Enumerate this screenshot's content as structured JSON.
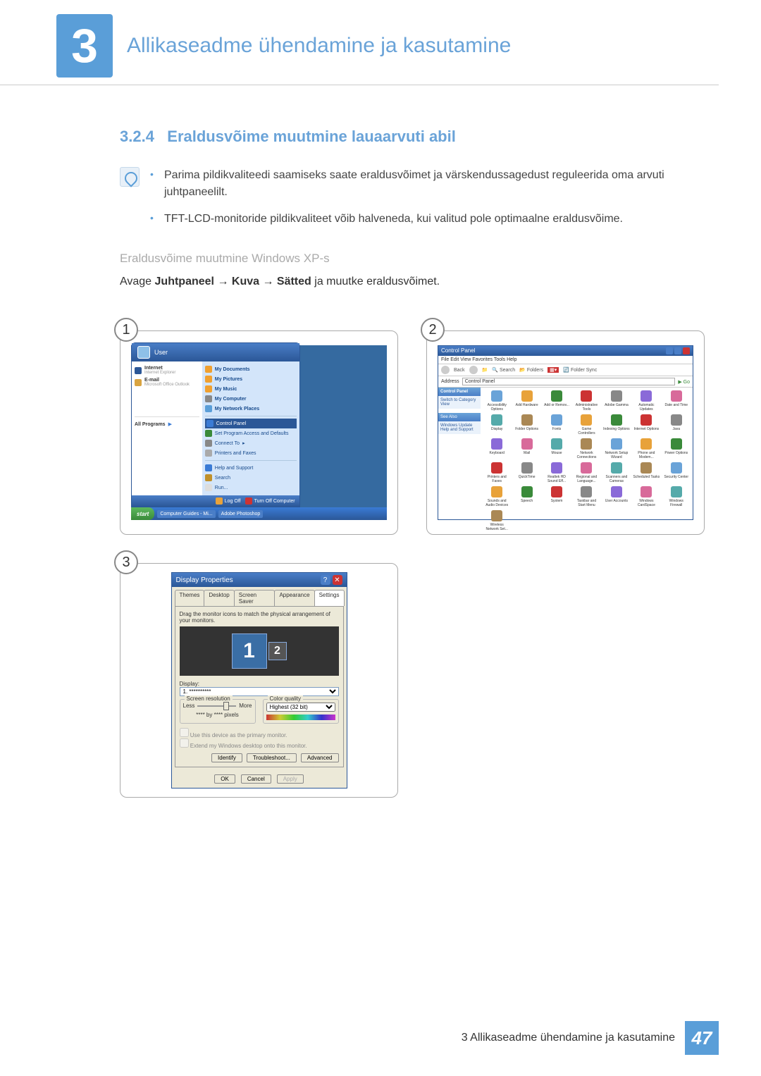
{
  "chapter": {
    "number": "3",
    "title": "Allikaseadme ühendamine ja kasutamine"
  },
  "section": {
    "number": "3.2.4",
    "title": "Eraldusvõime muutmine lauaarvuti abil"
  },
  "bullets": [
    "Parima pildikvaliteedi saamiseks saate eraldusvõimet ja värskendussagedust reguleerida oma arvuti juhtpaneelilt.",
    "TFT-LCD-monitoride pildikvaliteet võib halveneda, kui valitud pole optimaalne eraldusvõime."
  ],
  "sub_heading": "Eraldusvõime muutmine Windows XP-s",
  "instruction": {
    "prefix": "Avage ",
    "b1": "Juhtpaneel",
    "arrow": " → ",
    "b2": "Kuva",
    "b3": "Sätted",
    "suffix": " ja muutke eraldusvõimet."
  },
  "steps": {
    "s1": "1",
    "s2": "2",
    "s3": "3"
  },
  "start_menu": {
    "user": "User",
    "left": {
      "internet": "Internet",
      "internet_sub": "Internet Explorer",
      "email": "E-mail",
      "email_sub": "Microsoft Office Outlook",
      "all_programs": "All Programs"
    },
    "right": {
      "my_documents": "My Documents",
      "my_pictures": "My Pictures",
      "my_music": "My Music",
      "my_computer": "My Computer",
      "my_network": "My Network Places",
      "control_panel": "Control Panel",
      "set_program": "Set Program Access and Defaults",
      "connect_to": "Connect To",
      "printers": "Printers and Faxes",
      "help": "Help and Support",
      "search": "Search",
      "run": "Run..."
    },
    "footer": {
      "logoff": "Log Off",
      "turnoff": "Turn Off Computer"
    },
    "taskbar": {
      "start": "start",
      "t1": "Computer Guides - Mi...",
      "t2": "Adobe Photoshop"
    }
  },
  "control_panel": {
    "title": "Control Panel",
    "menu": "File   Edit   View   Favorites   Tools   Help",
    "toolbar": {
      "back": "Back",
      "search": "Search",
      "folders": "Folders",
      "foldersync": "Folder Sync"
    },
    "address_label": "Address",
    "address": "Control Panel",
    "go": "Go",
    "side": {
      "head": "Control Panel",
      "switch": "Switch to Category View",
      "see_also": "See Also",
      "wu": "Windows Update",
      "hs": "Help and Support"
    },
    "icons": [
      "Accessibility Options",
      "Add Hardware",
      "Add or Remov...",
      "Administrative Tools",
      "Adobe Gamma",
      "Automatic Updates",
      "Date and Time",
      "Display",
      "Folder Options",
      "Fonts",
      "Game Controllers",
      "Indexing Options",
      "Internet Options",
      "Java",
      "Keyboard",
      "Mail",
      "Mouse",
      "Network Connections",
      "Network Setup Wizard",
      "Phone and Modem...",
      "Power Options",
      "Printers and Faxes",
      "QuickTime",
      "Realtek HD Sound Eff...",
      "Regional and Language...",
      "Scanners and Cameras",
      "Scheduled Tasks",
      "Security Center",
      "Sounds and Audio Devices",
      "Speech",
      "System",
      "Taskbar and Start Menu",
      "User Accounts",
      "Windows CardSpace",
      "Windows Firewall",
      "Wireless Network Set..."
    ]
  },
  "display_props": {
    "title": "Display Properties",
    "tabs": [
      "Themes",
      "Desktop",
      "Screen Saver",
      "Appearance",
      "Settings"
    ],
    "desc": "Drag the monitor icons to match the physical arrangement of your monitors.",
    "mon1": "1",
    "mon2": "2",
    "display_label": "Display:",
    "display_value": "1. **********",
    "screen_res": "Screen resolution",
    "less": "Less",
    "more": "More",
    "res_value": "**** by **** pixels",
    "color_quality": "Color quality",
    "color_value": "Highest (32 bit)",
    "check1": "Use this device as the primary monitor.",
    "check2": "Extend my Windows desktop onto this monitor.",
    "identify": "Identify",
    "troubleshoot": "Troubleshoot...",
    "advanced": "Advanced",
    "ok": "OK",
    "cancel": "Cancel",
    "apply": "Apply"
  },
  "footer": {
    "text": "3 Allikaseadme ühendamine ja kasutamine",
    "page": "47"
  }
}
